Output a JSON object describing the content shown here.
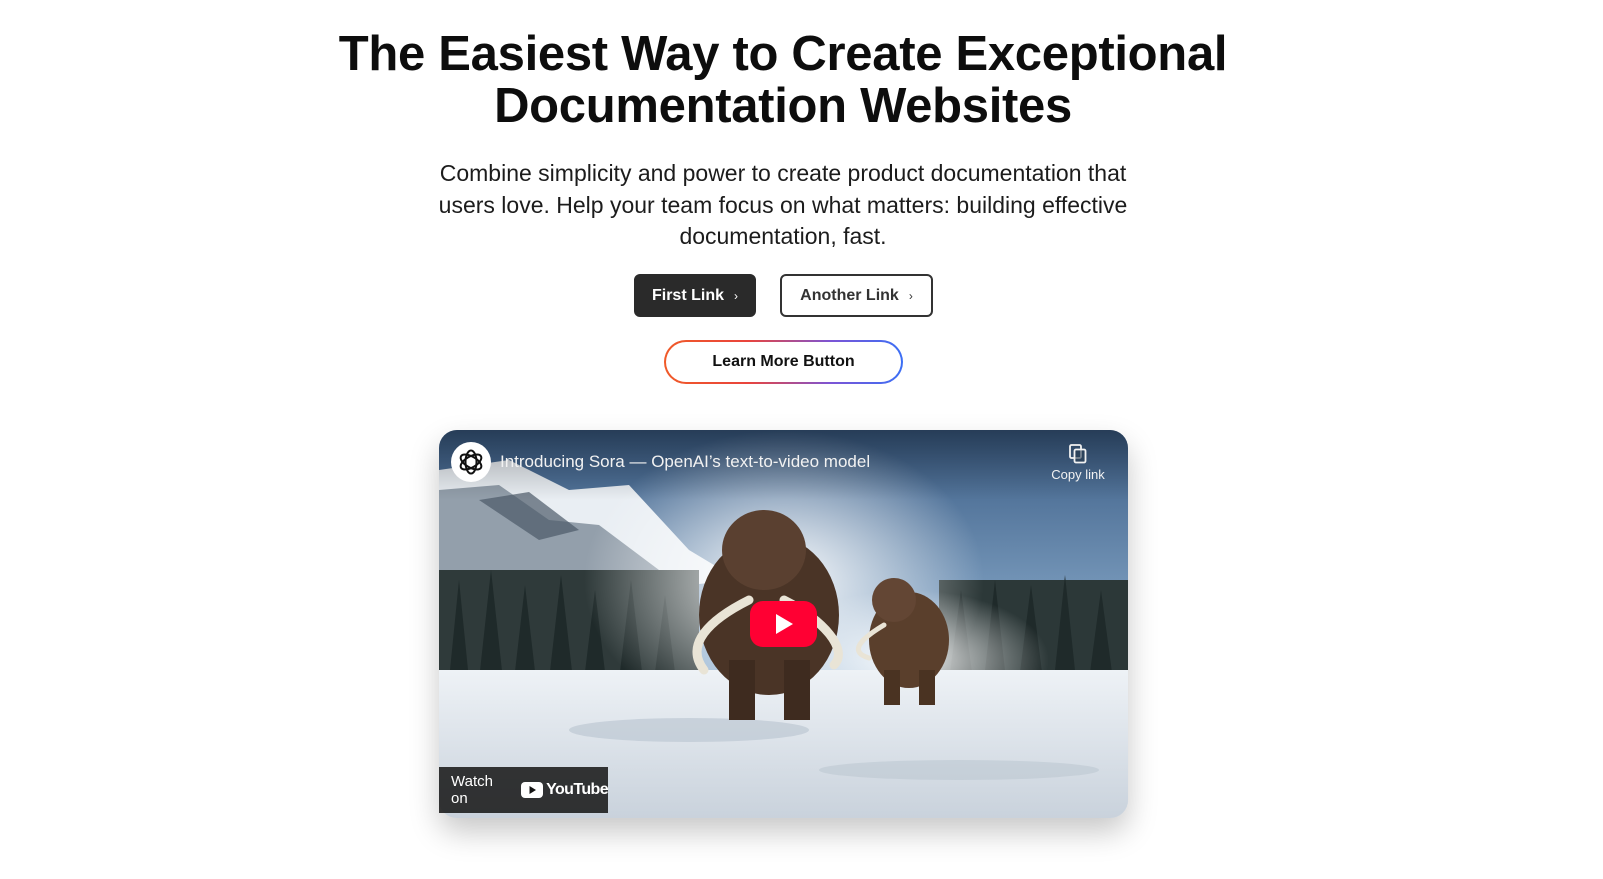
{
  "hero": {
    "title_line1": "The Easiest Way to Create Exceptional",
    "title_line2": "Documentation Websites",
    "subtitle": "Combine simplicity and power to create product documentation that users love. Help your team focus on what matters: building effective documentation, fast."
  },
  "buttons": {
    "first_link": "First Link",
    "another_link": "Another Link",
    "learn_more": "Learn More Button",
    "chevron": "›"
  },
  "video": {
    "title": "Introducing Sora — OpenAI’s text-to-video model",
    "copy_link": "Copy link",
    "watch_on": "Watch on",
    "youtube": "YouTube",
    "channel_icon": "openai-logo-icon",
    "play_icon": "play-icon"
  },
  "colors": {
    "primary_button": "#2a2a2a",
    "youtube_red": "#ff0033",
    "gradient_start": "#f05a28",
    "gradient_end": "#3b6ff5"
  }
}
